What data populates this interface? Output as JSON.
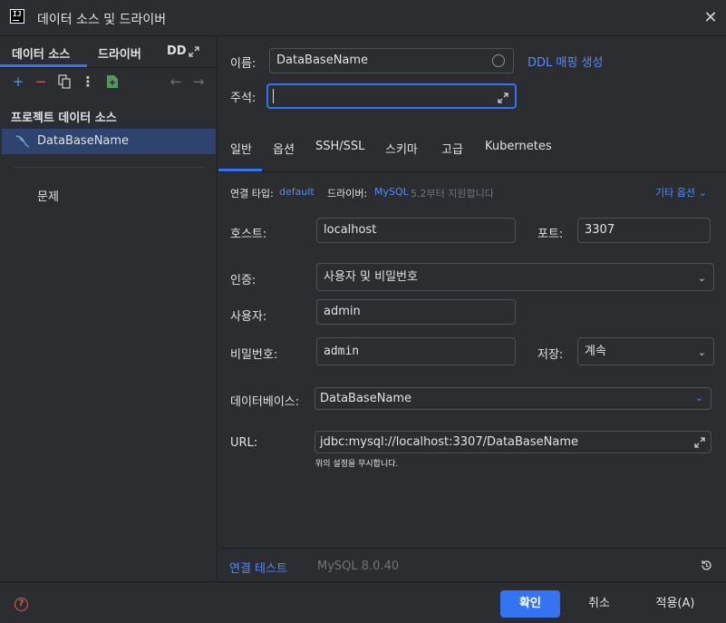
{
  "window": {
    "title": "데이터 소스 및 드라이버"
  },
  "left": {
    "tabs": [
      {
        "label": "데이터 소스"
      },
      {
        "label": "드라이버"
      },
      {
        "label": "DD"
      }
    ],
    "section_title": "프로젝트 데이터 소스",
    "datasource": {
      "name": "DataBaseName"
    },
    "problems": "문제"
  },
  "form": {
    "name_label": "이름:",
    "name_value": "DataBaseName",
    "ddl_link": "DDL 매핑 생성",
    "comment_label": "주석:",
    "comment_value": ""
  },
  "tabs": [
    {
      "label": "일반"
    },
    {
      "label": "옵션"
    },
    {
      "label": "SSH/SSL"
    },
    {
      "label": "스키마"
    },
    {
      "label": "고급"
    },
    {
      "label": "Kubernetes"
    }
  ],
  "general": {
    "connection_type_label": "연결 타입:",
    "connection_type_value": "default",
    "driver_label": "드라이버:",
    "driver_value": "MySQL",
    "driver_note": "5.2부터 지원합니다",
    "more_options": "기타 옵션",
    "host_label": "호스트:",
    "host_value": "localhost",
    "port_label": "포트:",
    "port_value": "3307",
    "auth_label": "인증:",
    "auth_value": "사용자 및 비밀번호",
    "user_label": "사용자:",
    "user_value": "admin",
    "password_label": "비밀번호:",
    "password_value": "admin",
    "save_label": "저장:",
    "save_value": "계속",
    "database_label": "데이터베이스:",
    "database_value": "DataBaseName",
    "url_label": "URL:",
    "url_value": "jdbc:mysql://localhost:3307/DataBaseName",
    "url_hint": "위의 설정을 무시합니다."
  },
  "test": {
    "link": "연결 테스트",
    "version": "MySQL 8.0.40"
  },
  "footer": {
    "ok": "확인",
    "cancel": "취소",
    "apply": "적용(A)"
  },
  "colors": {
    "accent": "#3574f0",
    "link": "#548af7",
    "background": "#2b2d30",
    "selection": "#2e436e"
  }
}
